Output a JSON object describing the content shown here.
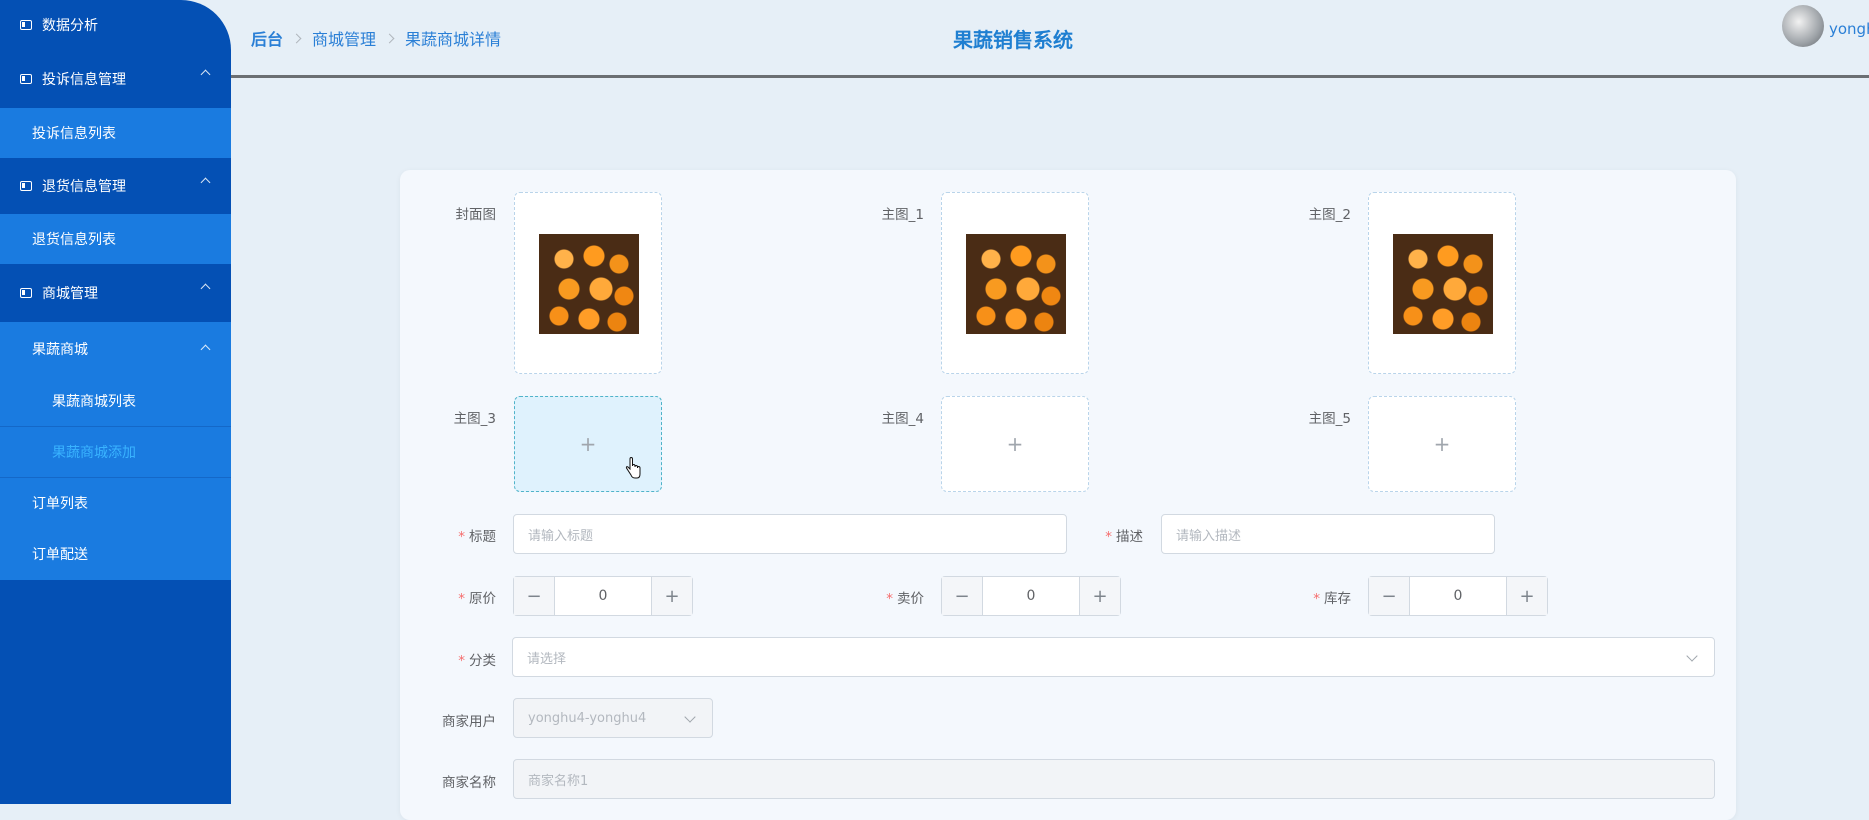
{
  "sidebar": {
    "items": [
      {
        "label": "数据分析"
      },
      {
        "label": "投诉信息管理"
      },
      {
        "label": "投诉信息列表"
      },
      {
        "label": "退货信息管理"
      },
      {
        "label": "退货信息列表"
      },
      {
        "label": "商城管理"
      },
      {
        "label": "果蔬商城"
      },
      {
        "label": "果蔬商城列表"
      },
      {
        "label": "果蔬商城添加"
      },
      {
        "label": "订单列表"
      },
      {
        "label": "订单配送"
      }
    ]
  },
  "header": {
    "breadcrumb": [
      "后台",
      "商城管理",
      "果蔬商城详情"
    ],
    "title": "果蔬销售系统",
    "username": "yongh"
  },
  "form": {
    "cover_label": "封面图",
    "main1_label": "主图_1",
    "main2_label": "主图_2",
    "main3_label": "主图_3",
    "main4_label": "主图_4",
    "main5_label": "主图_5",
    "plus": "+",
    "title_label": "标题",
    "title_placeholder": "请输入标题",
    "desc_label": "描述",
    "desc_placeholder": "请输入描述",
    "orig_price_label": "原价",
    "orig_price_value": "0",
    "sale_price_label": "卖价",
    "sale_price_value": "0",
    "stock_label": "库存",
    "stock_value": "0",
    "category_label": "分类",
    "category_placeholder": "请选择",
    "merchant_user_label": "商家用户",
    "merchant_user_value": "yonghu4-yonghu4",
    "merchant_name_label": "商家名称",
    "merchant_name_value": "商家名称1",
    "required_mark": "*",
    "minus": "−"
  }
}
